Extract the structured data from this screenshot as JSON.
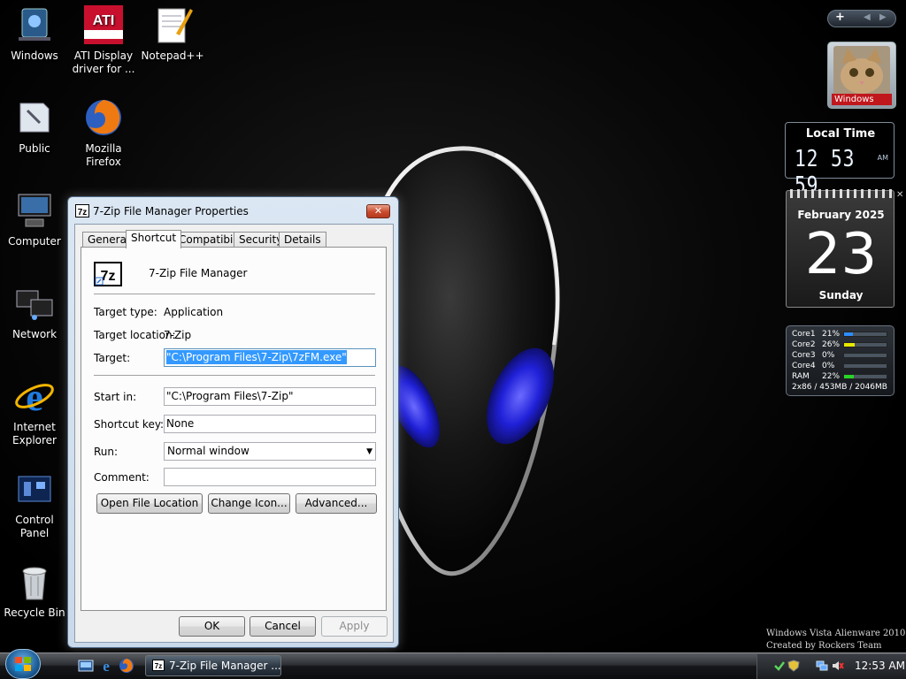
{
  "desktop": {
    "icons": [
      {
        "label": "Windows",
        "icon": "windows-folder-icon"
      },
      {
        "label": "ATI Display driver for ...",
        "icon": "ati-radeon-icon"
      },
      {
        "label": "Notepad++",
        "icon": "notepad-plus-plus-icon"
      },
      {
        "label": "Public",
        "icon": "public-folder-icon"
      },
      {
        "label": "Mozilla Firefox",
        "icon": "firefox-icon"
      },
      {
        "label": "Computer",
        "icon": "computer-icon"
      },
      {
        "label": "Network",
        "icon": "network-icon"
      },
      {
        "label": "Internet Explorer",
        "icon": "internet-explorer-icon"
      },
      {
        "label": "Control Panel",
        "icon": "control-panel-icon"
      },
      {
        "label": "Recycle Bin",
        "icon": "recycle-bin-icon"
      }
    ],
    "watermark": [
      "Windows Vista Alienware 2010",
      "Created by Rockers Team"
    ]
  },
  "dialog": {
    "title": "7-Zip File Manager Properties",
    "close_label": "✕",
    "tabs": [
      {
        "label": "General",
        "active": false
      },
      {
        "label": "Shortcut",
        "active": true
      },
      {
        "label": "Compatibility",
        "active": false
      },
      {
        "label": "Security",
        "active": false
      },
      {
        "label": "Details",
        "active": false
      }
    ],
    "app_name": "7-Zip File Manager",
    "target_type_label": "Target type:",
    "target_type_value": "Application",
    "target_location_label": "Target location:",
    "target_location_value": "7-Zip",
    "target_label": "Target:",
    "target_value": "\"C:\\Program Files\\7-Zip\\7zFM.exe\"",
    "start_in_label": "Start in:",
    "start_in_value": "\"C:\\Program Files\\7-Zip\"",
    "shortcut_key_label": "Shortcut key:",
    "shortcut_key_value": "None",
    "run_label": "Run:",
    "run_value": "Normal window",
    "comment_label": "Comment:",
    "comment_value": "",
    "open_file_location": "Open File Location",
    "change_icon": "Change Icon...",
    "advanced": "Advanced...",
    "ok": "OK",
    "cancel": "Cancel",
    "apply": "Apply"
  },
  "gadgets": {
    "user_tile_name": "Windows",
    "clock_title": "Local Time",
    "clock_time": "12 53 59",
    "clock_ampm": "AM",
    "calendar_month": "February 2025",
    "calendar_day": "23",
    "calendar_weekday": "Sunday",
    "cpu_rows": [
      {
        "name": "Core1",
        "percent": "21%",
        "level": 0.21,
        "color": "#2f8cff"
      },
      {
        "name": "Core2",
        "percent": "26%",
        "level": 0.26,
        "color": "#e8e800"
      },
      {
        "name": "Core3",
        "percent": "0%",
        "level": 0,
        "color": "#2f8cff"
      },
      {
        "name": "Core4",
        "percent": "0%",
        "level": 0,
        "color": "#2f8cff"
      },
      {
        "name": "RAM",
        "percent": "22%",
        "level": 0.22,
        "color": "#28d428"
      }
    ],
    "cpu_footer": "2x86 / 453MB / 2046MB"
  },
  "taskbar": {
    "task_label": "7-Zip File Manager ...",
    "clock": "12:53 AM"
  }
}
